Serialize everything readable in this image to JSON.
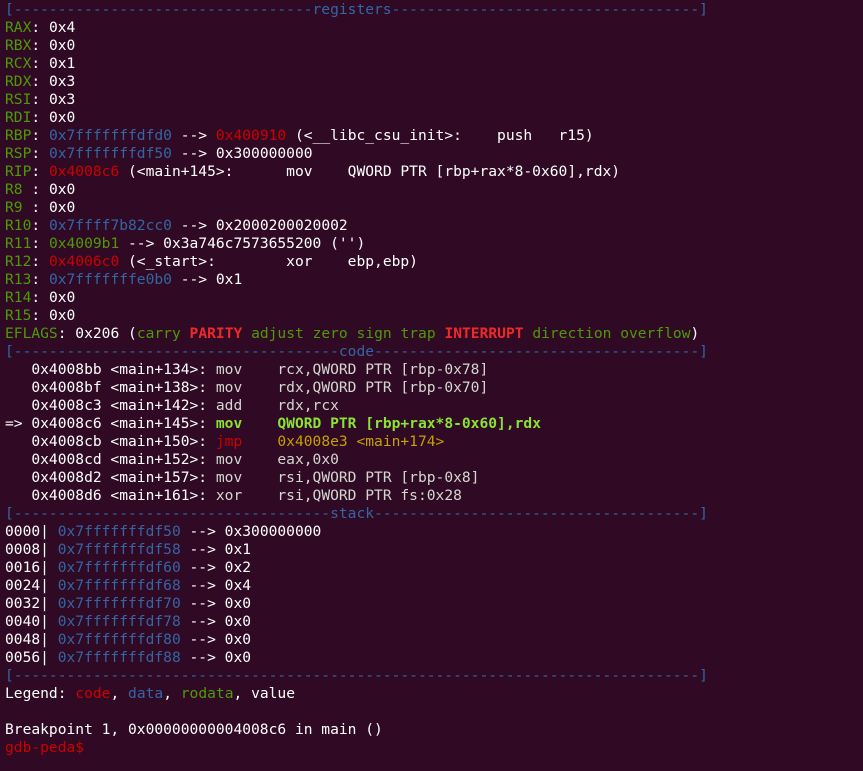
{
  "banners": {
    "registers": "[----------------------------------registers-----------------------------------]",
    "code": "[-------------------------------------code-------------------------------------]",
    "stack": "[------------------------------------stack-------------------------------------]",
    "end": "[------------------------------------------------------------------------------]"
  },
  "registers": [
    {
      "name": "RAX",
      "sep": ": ",
      "value": "0x4"
    },
    {
      "name": "RBX",
      "sep": ": ",
      "value": "0x0"
    },
    {
      "name": "RCX",
      "sep": ": ",
      "value": "0x1"
    },
    {
      "name": "RDX",
      "sep": ": ",
      "value": "0x3"
    },
    {
      "name": "RSI",
      "sep": ": ",
      "value": "0x3"
    },
    {
      "name": "RDI",
      "sep": ": ",
      "value": "0x0"
    }
  ],
  "rbp": {
    "name": "RBP",
    "sep": ": ",
    "addr1": "0x7fffffffdfd0",
    "arrow": " --> ",
    "addr2": "0x400910",
    "rest": " (<__libc_csu_init>:    push   r15)"
  },
  "rsp": {
    "name": "RSP",
    "sep": ": ",
    "addr1": "0x7fffffffdf50",
    "arrow": " --> ",
    "value": "0x300000000"
  },
  "rip": {
    "name": "RIP",
    "sep": ": ",
    "addr": "0x4008c6",
    "rest": " (<main+145>:      mov    QWORD PTR [rbp+rax*8-0x60],rdx)"
  },
  "r8": {
    "name": "R8 ",
    "sep": ": ",
    "value": "0x0"
  },
  "r9": {
    "name": "R9 ",
    "sep": ": ",
    "value": "0x0"
  },
  "r10": {
    "name": "R10",
    "sep": ": ",
    "addr": "0x7ffff7b82cc0",
    "arrow": " --> ",
    "value": "0x2000200020002"
  },
  "r11": {
    "name": "R11",
    "sep": ": ",
    "addr": "0x4009b1",
    "arrow": " --> ",
    "value": "0x3a746c7573655200 ('')"
  },
  "r12": {
    "name": "R12",
    "sep": ": ",
    "addr": "0x4006c0",
    "rest": " (<_start>:        xor    ebp,ebp)"
  },
  "r13": {
    "name": "R13",
    "sep": ": ",
    "addr": "0x7fffffffe0b0",
    "arrow": " --> ",
    "value": "0x1"
  },
  "r14": {
    "name": "R14",
    "sep": ": ",
    "value": "0x0"
  },
  "r15": {
    "name": "R15",
    "sep": ": ",
    "value": "0x0"
  },
  "eflags": {
    "name": "EFLAGS",
    "sep": ": ",
    "value": "0x206",
    "open": " (",
    "close": ")",
    "flags": [
      {
        "text": "carry",
        "set": false
      },
      {
        "text": "PARITY",
        "set": true
      },
      {
        "text": "adjust",
        "set": false
      },
      {
        "text": "zero",
        "set": false
      },
      {
        "text": "sign",
        "set": false
      },
      {
        "text": "trap",
        "set": false
      },
      {
        "text": "INTERRUPT",
        "set": true
      },
      {
        "text": "direction",
        "set": false
      },
      {
        "text": "overflow",
        "set": false
      }
    ]
  },
  "code": [
    {
      "prefix": "   ",
      "addr": "0x4008bb <main+134>:",
      "op": " mov    ",
      "args": "rcx,QWORD PTR [rbp-0x78]",
      "style": "normal"
    },
    {
      "prefix": "   ",
      "addr": "0x4008bf <main+138>:",
      "op": " mov    ",
      "args": "rdx,QWORD PTR [rbp-0x70]",
      "style": "normal"
    },
    {
      "prefix": "   ",
      "addr": "0x4008c3 <main+142>:",
      "op": " add    ",
      "args": "rdx,rcx",
      "style": "normal"
    },
    {
      "prefix": "=> ",
      "addr": "0x4008c6 <main+145>:",
      "op": " mov    ",
      "args": "QWORD PTR [rbp+rax*8-0x60],rdx",
      "style": "current"
    },
    {
      "prefix": "   ",
      "addr": "0x4008cb <main+150>:",
      "op": " jmp    ",
      "args": "0x4008e3 <main+174>",
      "style": "jump"
    },
    {
      "prefix": "   ",
      "addr": "0x4008cd <main+152>:",
      "op": " mov    ",
      "args": "eax,0x0",
      "style": "normal"
    },
    {
      "prefix": "   ",
      "addr": "0x4008d2 <main+157>:",
      "op": " mov    ",
      "args": "rsi,QWORD PTR [rbp-0x8]",
      "style": "normal"
    },
    {
      "prefix": "   ",
      "addr": "0x4008d6 <main+161>:",
      "op": " xor    ",
      "args": "rsi,QWORD PTR fs:0x28",
      "style": "normal"
    }
  ],
  "stack": [
    {
      "offset": "0000| ",
      "addr": "0x7fffffffdf50",
      "arrow": " --> ",
      "value": "0x300000000"
    },
    {
      "offset": "0008| ",
      "addr": "0x7fffffffdf58",
      "arrow": " --> ",
      "value": "0x1"
    },
    {
      "offset": "0016| ",
      "addr": "0x7fffffffdf60",
      "arrow": " --> ",
      "value": "0x2"
    },
    {
      "offset": "0024| ",
      "addr": "0x7fffffffdf68",
      "arrow": " --> ",
      "value": "0x4"
    },
    {
      "offset": "0032| ",
      "addr": "0x7fffffffdf70",
      "arrow": " --> ",
      "value": "0x0"
    },
    {
      "offset": "0040| ",
      "addr": "0x7fffffffdf78",
      "arrow": " --> ",
      "value": "0x0"
    },
    {
      "offset": "0048| ",
      "addr": "0x7fffffffdf80",
      "arrow": " --> ",
      "value": "0x0"
    },
    {
      "offset": "0056| ",
      "addr": "0x7fffffffdf88",
      "arrow": " --> ",
      "value": "0x0"
    }
  ],
  "legend": {
    "label": "Legend: ",
    "code": "code",
    "sep1": ", ",
    "data": "data",
    "sep2": ", ",
    "rodata": "rodata",
    "sep3": ", ",
    "value": "value"
  },
  "breakpoint_message": "Breakpoint 1, 0x00000000004008c6 in main ()",
  "prompt": "gdb-peda$ "
}
